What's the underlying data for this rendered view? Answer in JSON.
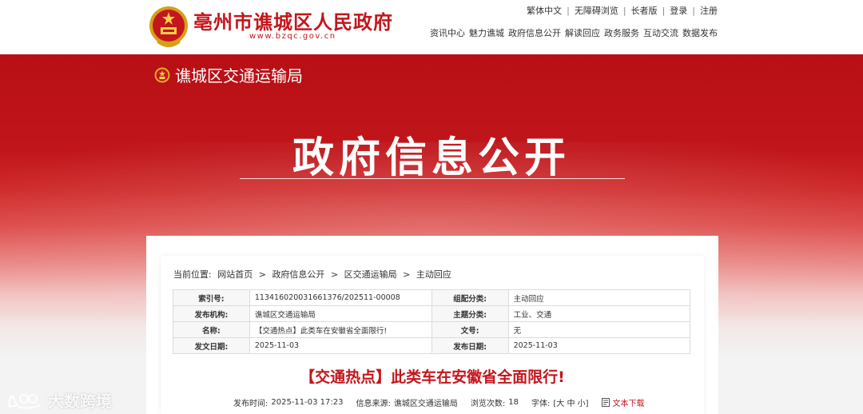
{
  "header": {
    "site_title": "亳州市谯城区人民政府",
    "site_url": "www.bzqc.gov.cn",
    "util_links": [
      "繁体中文",
      "无障碍浏览",
      "长者版",
      "登录",
      "注册"
    ],
    "util_sep": "|",
    "nav": [
      "资讯中心",
      "魅力谯城",
      "政府信息公开",
      "解读回应",
      "政务服务",
      "互动交流",
      "数据发布"
    ]
  },
  "banner": {
    "dept_name": "谯城区交通运输局",
    "big_title": "政府信息公开"
  },
  "breadcrumb": {
    "label": "当前位置:",
    "items": [
      "网站首页",
      "政府信息公开",
      "区交通运输局",
      "主动回应"
    ],
    "sep": ">"
  },
  "meta_table": [
    {
      "k1": "索引号:",
      "v1": "11341602003166137​6/202511-00008",
      "k2": "组配分类:",
      "v2": "主动回应"
    },
    {
      "k1": "发布机构:",
      "v1": "谯城区交通运输局",
      "k2": "主题分类:",
      "v2": "工业、交通"
    },
    {
      "k1": "名称:",
      "v1": "【交通热点】此类车在安徽省全面限行!",
      "k2": "文号:",
      "v2": "无"
    },
    {
      "k1": "发文日期:",
      "v1": "2025-11-03",
      "k2": "发布日期:",
      "v2": "2025-11-03"
    }
  ],
  "article": {
    "title": "【交通热点】此类车在安徽省全面限行!",
    "publish_label": "发布时间:",
    "publish_time": "2025-11-03 17:23",
    "source_label": "信息来源:",
    "source": "谯城区交通运输局",
    "views_label": "浏览次数:",
    "views": "18",
    "font_label": "字体:",
    "font_sizes": "[大 中 小]",
    "download": "文本下载"
  },
  "watermark": {
    "text": "大数跨境"
  },
  "colors": {
    "brand_red": "#c4161c",
    "banner_red": "#b80f15"
  }
}
